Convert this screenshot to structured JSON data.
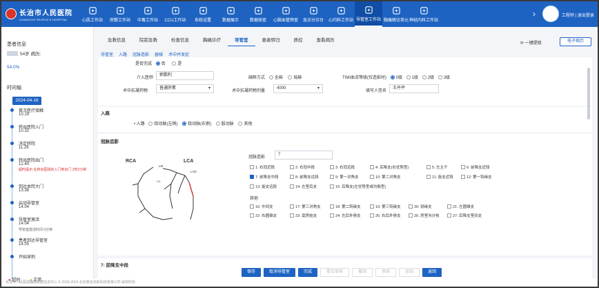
{
  "header": {
    "logo_title": "长治市人民医院",
    "logo_sub": "CHANGZHI PEOPLE'S HOSPITAL",
    "nav": [
      "心肌工作站",
      "房颤工作站",
      "中毒工作站",
      "CCU工作站",
      "系统设置",
      "数据展示",
      "数据核查",
      "心脑血管筛查",
      "急诊分诊台",
      "心内科工作站",
      "导管室工作站",
      "胸痛随访单元",
      "神经内科工作站"
    ],
    "active_nav": "导管室工作站",
    "user": "工程师 | 退出登录"
  },
  "left": {
    "patient_title": "患者信息",
    "patient_line": "54岁  病历:",
    "patient_pct": "54.0%",
    "timeline_title": "时间轴",
    "date": "2024-04-16",
    "events": [
      {
        "name": "首次医疗接触",
        "time": "10.19"
      },
      {
        "name": "转出医院入门",
        "time": "10.32"
      },
      {
        "name": "决定转院",
        "time": "11.28"
      },
      {
        "name": "转出医院出门",
        "time": "12.40",
        "note": "超时提示:在转出医院的入门到出门 2时2分钟"
      },
      {
        "name": "到达本院大门",
        "time": "13.38"
      },
      {
        "name": "启动导管室",
        "time": "14.04"
      },
      {
        "name": "导管室激活",
        "time": "14.04",
        "note2": "导管室激活时间 0分钟"
      },
      {
        "name": "患者到达导管室",
        "time": "14.05"
      },
      {
        "name": "开始穿刺",
        "time": ""
      }
    ],
    "legend": "● 超时     ● 正常"
  },
  "main": {
    "tabs": [
      "急救信息",
      "院前急救",
      "检查信息",
      "胸痛诊疗",
      "导管室",
      "患者转归",
      "质控",
      "查看病历"
    ],
    "active_tab": "导管室",
    "apply": "一键提取",
    "emr": "电子病历",
    "subtabs": [
      "导管室",
      "入路",
      "冠脉造影",
      "器械",
      "术中并发症"
    ],
    "is_done_label": "是否完成",
    "no_label": "否",
    "yes_label": "是",
    "intervene_label": "介入医师",
    "intervene_val": "郭鹏利",
    "anes_label": "麻醉方式",
    "anes_opts": [
      "全麻",
      "局麻"
    ],
    "timi_label": "TIMI血流等级(仅造影时)",
    "timi_opts": [
      "0级",
      "1级",
      "2级",
      "3级"
    ],
    "drug_label": "术中抗凝药物",
    "drug_val": "普通肝素",
    "dose_label": "术中抗凝药物剂量",
    "dose_val": "4000",
    "sign_label": "填写人签名",
    "sign_val": "王丹平",
    "route_title": "入路",
    "route_label": "• 入路",
    "route_opts": [
      "桡动脉(左侧)",
      "桡动脉(右侧)",
      "股动脉",
      "其他"
    ],
    "angio_title": "冠脉造影",
    "angio_count_label": "冠脉造影",
    "angio_count": "7",
    "vessels": [
      "1: 右冠近段",
      "2: 右冠中段",
      "3: 右冠远段",
      "4: 后降支(右优势型)",
      "5: 左主干",
      "6: 前降支近段",
      "7: 前降支中段",
      "8: 前降支远段",
      "9: 第一对角支",
      "10: 第二对角支",
      "11: 旋支近段",
      "12: 第一钝缘支",
      "13: 旋支远段",
      "14: 左室后支",
      "15: 后降支(左优势型或均衡型)"
    ],
    "other_label": "其他",
    "others": [
      "16: 中间支",
      "17: 第三对角支",
      "18: 第二钝缘支",
      "19: 第三钝缘支",
      "20: 锐缘支",
      "21: 左圆锥支",
      "22: 右圆锥支",
      "23: 窦房结支",
      "24: 左后外侧支",
      "25: 右后外侧支",
      "26: 房室沟分枝",
      "27: 后降支室间支"
    ],
    "rca": "RCA",
    "lca": "LCA",
    "lm": "LM",
    "lad": "LAD",
    "cx": "CX",
    "selected_title": "7: 前降支中段",
    "buttons": [
      "保存",
      "取消导管室",
      "完成",
      "提交审核",
      "撤回",
      "审核",
      "驳回",
      "返回"
    ]
  },
  "footer": "长治市人民医院胸痛数据信息中心 © 2009-2024 北京麦迪克斯科技有限公司 版权所有"
}
